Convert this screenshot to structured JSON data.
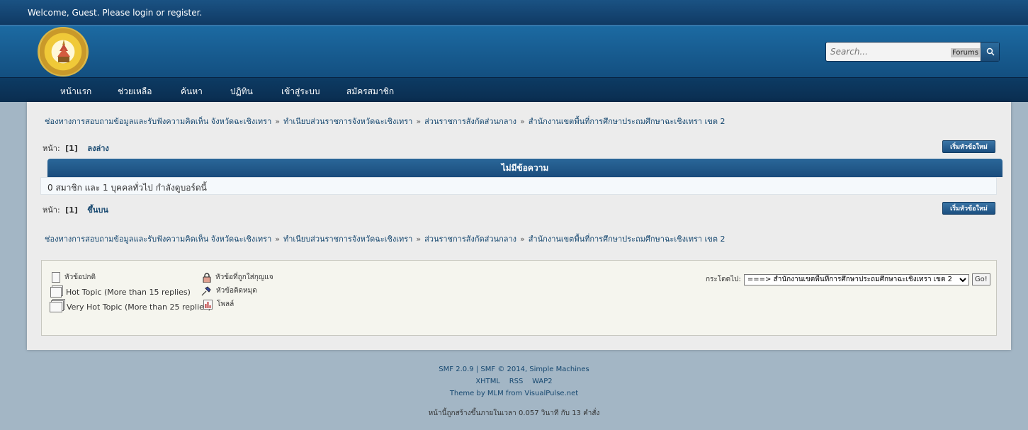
{
  "topbar": {
    "welcome": "Welcome, Guest. Please login or register."
  },
  "search": {
    "placeholder": "Search...",
    "scope": "Forums"
  },
  "nav": [
    "หน้าแรก",
    "ช่วยเหลือ",
    "ค้นหา",
    "ปฏิทิน",
    "เข้าสู่ระบบ",
    "สมัครสมาชิก"
  ],
  "breadcrumb": [
    "ช่องทางการสอบถามข้อมูลและรับฟังความคิดเห็น จังหวัดฉะเชิงเทรา",
    "ทำเนียบส่วนราชการจังหวัดฉะเชิงเทรา",
    "ส่วนราชการสังกัดส่วนกลาง",
    "สำนักงานเขตพื้นที่การศึกษาประถมศึกษาฉะเชิงเทรา เขต 2"
  ],
  "breadcrumb_sep": "»",
  "pages": {
    "label": "หน้า:",
    "current": "[1]",
    "down_link": "ลงล่าง",
    "up_link": "ขึ้นบน"
  },
  "new_topic_button": "เริ่มหัวข้อใหม่",
  "table": {
    "header": "ไม่มีข้อความ",
    "viewers": "0 สมาชิก และ 1 บุคคลทั่วไป กำลังดูบอร์ดนี้"
  },
  "legend": {
    "normal": "หัวข้อปกติ",
    "hot": "Hot Topic (More than 15 replies)",
    "very_hot": "Very Hot Topic (More than 25 replies)",
    "locked": "หัวข้อที่ถูกใส่กุญแจ",
    "sticky": "หัวข้อติดหมุด",
    "poll": "โพลล์"
  },
  "jump": {
    "label": "กระโดดไป:",
    "selected": "===> สำนักงานเขตพื้นที่การศึกษาประถมศึกษาฉะเชิงเทรา เขต 2",
    "go": "Go!"
  },
  "footer": {
    "line1_a": "SMF 2.0.9",
    "line1_sep": "|",
    "line1_b": "SMF © 2014, Simple Machines",
    "links": [
      "XHTML",
      "RSS",
      "WAP2"
    ],
    "theme": "Theme by MLM from VisualPulse.net",
    "time": "หน้านี้ถูกสร้างขึ้นภายในเวลา 0.057 วินาที กับ 13 คำสั่ง"
  }
}
